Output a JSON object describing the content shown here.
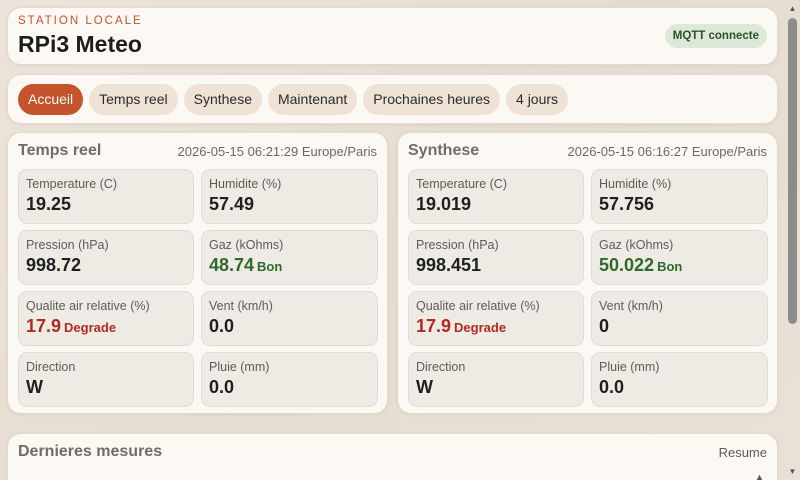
{
  "header": {
    "eyebrow": "STATION LOCALE",
    "title": "RPi3 Meteo",
    "status_badge": "MQTT connecte"
  },
  "nav": {
    "tabs": [
      {
        "label": "Accueil",
        "active": true
      },
      {
        "label": "Temps reel",
        "active": false
      },
      {
        "label": "Synthese",
        "active": false
      },
      {
        "label": "Maintenant",
        "active": false
      },
      {
        "label": "Prochaines heures",
        "active": false
      },
      {
        "label": "4 jours",
        "active": false
      }
    ]
  },
  "panels": [
    {
      "title": "Temps reel",
      "timestamp": "2026-05-15 06:21:29 Europe/Paris",
      "metrics": [
        {
          "label": "Temperature (C)",
          "value": "19.25",
          "tag": "",
          "status": ""
        },
        {
          "label": "Humidite (%)",
          "value": "57.49",
          "tag": "",
          "status": ""
        },
        {
          "label": "Pression (hPa)",
          "value": "998.72",
          "tag": "",
          "status": ""
        },
        {
          "label": "Gaz (kOhms)",
          "value": "48.74",
          "tag": "Bon",
          "status": "good"
        },
        {
          "label": "Qualite air relative (%)",
          "value": "17.9",
          "tag": "Degrade",
          "status": "bad"
        },
        {
          "label": "Vent (km/h)",
          "value": "0.0",
          "tag": "",
          "status": ""
        },
        {
          "label": "Direction",
          "value": "W",
          "tag": "",
          "status": ""
        },
        {
          "label": "Pluie (mm)",
          "value": "0.0",
          "tag": "",
          "status": ""
        }
      ]
    },
    {
      "title": "Synthese",
      "timestamp": "2026-05-15 06:16:27 Europe/Paris",
      "metrics": [
        {
          "label": "Temperature (C)",
          "value": "19.019",
          "tag": "",
          "status": ""
        },
        {
          "label": "Humidite (%)",
          "value": "57.756",
          "tag": "",
          "status": ""
        },
        {
          "label": "Pression (hPa)",
          "value": "998.451",
          "tag": "",
          "status": ""
        },
        {
          "label": "Gaz (kOhms)",
          "value": "50.022",
          "tag": "Bon",
          "status": "good"
        },
        {
          "label": "Qualite air relative (%)",
          "value": "17.9",
          "tag": "Degrade",
          "status": "bad"
        },
        {
          "label": "Vent (km/h)",
          "value": "0",
          "tag": "",
          "status": ""
        },
        {
          "label": "Direction",
          "value": "W",
          "tag": "",
          "status": ""
        },
        {
          "label": "Pluie (mm)",
          "value": "0.0",
          "tag": "",
          "status": ""
        }
      ]
    }
  ],
  "measures": {
    "title": "Dernieres mesures",
    "link": "Resume"
  },
  "colors": {
    "accent": "#c5532c",
    "good": "#2f6a2b",
    "bad": "#b02a22",
    "badge_bg": "#dde9d8"
  },
  "icons": {
    "sort": "sort-arrows-icon",
    "scroll_up": "scroll-up-arrow-icon",
    "scroll_down": "scroll-down-arrow-icon"
  }
}
